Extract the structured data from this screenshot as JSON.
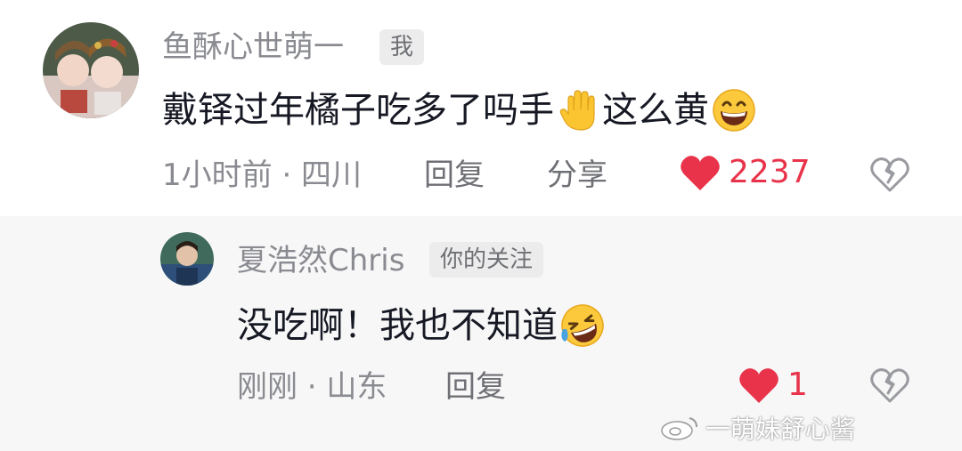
{
  "colors": {
    "like_red": "#e8334a",
    "meta_gray": "#8a8b91",
    "reply_bg": "#f7f7f7"
  },
  "comment": {
    "username": "鱼酥心世萌一",
    "tag": "我",
    "text": "戴铎过年橘子吃多了吗手",
    "emoji_1": "raised-hand-emoji",
    "text_2": "这么黄",
    "emoji_2": "grinning-face-emoji",
    "time_location": "1小时前 · 四川",
    "reply_label": "回复",
    "share_label": "分享",
    "like_count": "2237",
    "liked": true
  },
  "reply": {
    "username": "夏浩然Chris",
    "tag": "你的关注",
    "text": "没吃啊！我也不知道",
    "emoji": "rolling-on-floor-laughing-emoji",
    "time_location": "刚刚 · 山东",
    "reply_label": "回复",
    "like_count": "1",
    "liked": true
  },
  "watermark": {
    "text": "一萌妹舒心酱"
  }
}
